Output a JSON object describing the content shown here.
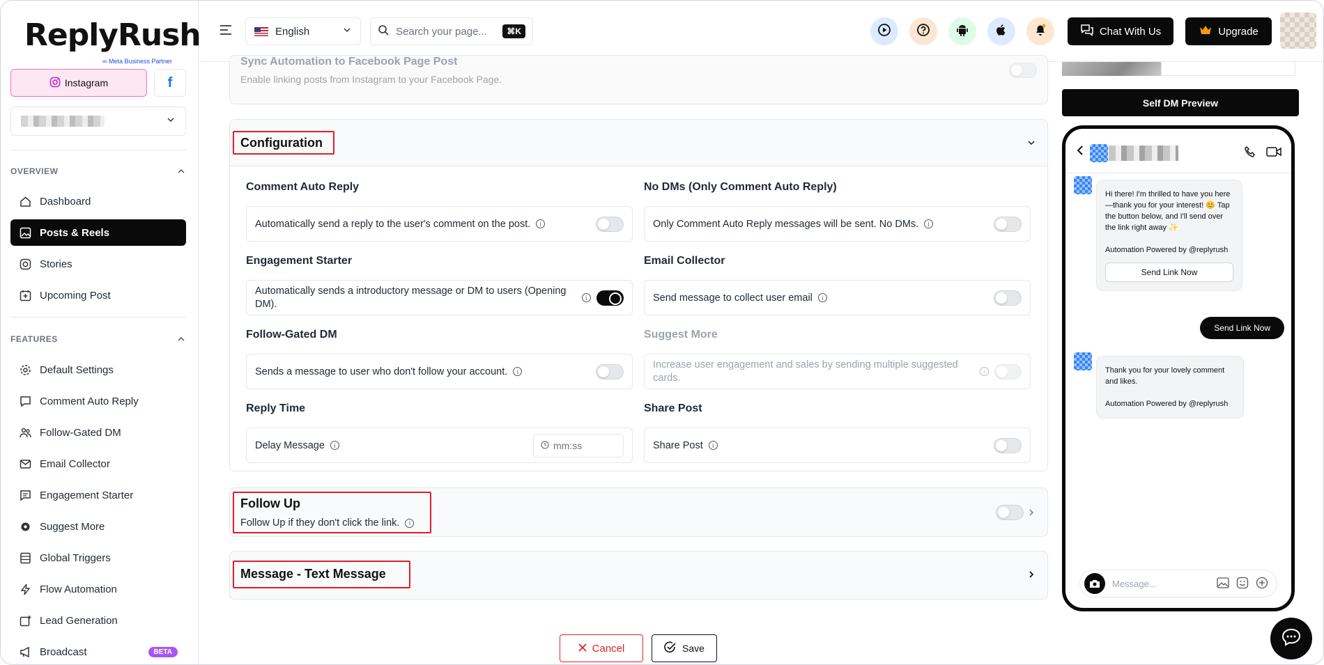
{
  "brand": {
    "name": "ReplyRush",
    "partner": "∞ Meta Business Partner"
  },
  "account": {
    "instagram_label": "Instagram",
    "facebook_label": "f"
  },
  "sidebar": {
    "overview_label": "OVERVIEW",
    "overview_items": [
      {
        "label": "Dashboard",
        "icon": "home-icon"
      },
      {
        "label": "Posts & Reels",
        "icon": "image-icon",
        "active": true
      },
      {
        "label": "Stories",
        "icon": "instagram-icon"
      },
      {
        "label": "Upcoming Post",
        "icon": "calendar-plus-icon"
      }
    ],
    "features_label": "FEATURES",
    "feature_items": [
      {
        "label": "Default Settings",
        "icon": "gear-icon"
      },
      {
        "label": "Comment Auto Reply",
        "icon": "comment-icon"
      },
      {
        "label": "Follow-Gated DM",
        "icon": "users-icon"
      },
      {
        "label": "Email Collector",
        "icon": "mail-icon"
      },
      {
        "label": "Engagement Starter",
        "icon": "chat-list-icon"
      },
      {
        "label": "Suggest More",
        "icon": "cog-badge-icon"
      },
      {
        "label": "Global Triggers",
        "icon": "layers-icon"
      },
      {
        "label": "Flow Automation",
        "icon": "bolt-icon"
      },
      {
        "label": "Lead Generation",
        "icon": "lead-icon"
      },
      {
        "label": "Broadcast",
        "icon": "megaphone-icon",
        "badge": "BETA"
      }
    ]
  },
  "header": {
    "language": "English",
    "search_placeholder": "Search your page...",
    "shortcut": "⌘K",
    "chat_label": "Chat With Us",
    "upgrade_label": "Upgrade"
  },
  "sync": {
    "title": "Sync Automation to Facebook Page Post",
    "desc": "Enable linking posts from Instagram to your Facebook Page."
  },
  "config": {
    "title": "Configuration",
    "fields": {
      "comment_auto_reply": {
        "label": "Comment Auto Reply",
        "text": "Automatically send a reply to the user's comment on the post.",
        "on": false
      },
      "no_dms": {
        "label": "No DMs (Only Comment Auto Reply)",
        "text": "Only Comment Auto Reply messages will be sent. No DMs.",
        "on": false
      },
      "engagement_starter": {
        "label": "Engagement Starter",
        "text": "Automatically sends a introductory message or DM to users (Opening DM).",
        "on": true
      },
      "email_collector": {
        "label": "Email Collector",
        "text": "Send message to collect user email",
        "on": false
      },
      "follow_gated": {
        "label": "Follow-Gated DM",
        "text": "Sends a message to user who don't follow your account.",
        "on": false
      },
      "suggest_more": {
        "label": "Suggest More",
        "text": "Increase user engagement and sales by sending multiple suggested cards.",
        "on": false
      },
      "reply_time": {
        "label": "Reply Time",
        "text": "Delay Message",
        "placeholder": "mm:ss"
      },
      "share_post": {
        "label": "Share Post",
        "text": "Share Post",
        "on": false
      }
    }
  },
  "follow_up": {
    "title": "Follow Up",
    "desc": "Follow Up if they don't click the link.",
    "on": false
  },
  "message": {
    "title": "Message - Text Message"
  },
  "actions": {
    "cancel": "Cancel",
    "save": "Save"
  },
  "preview": {
    "button": "Self DM Preview",
    "msg1": "Hi there! I'm thrilled to have you here—thank you for your interest! 😊 Tap the button below, and I'll send over the link right away ✨",
    "msg1_footer": "Automation Powered by @replyrush",
    "msg1_button": "Send Link Now",
    "sent": "Send Link Now",
    "msg2": "Thank you for your lovely comment and likes.",
    "msg2_footer": "Automation Powered by @replyrush",
    "input_placeholder": "Message..."
  },
  "colors": {
    "accent": "#0a0a0a",
    "highlight": "#e11d2a",
    "instagram_bg": "#fde7f2",
    "beta": "#a855f7"
  }
}
